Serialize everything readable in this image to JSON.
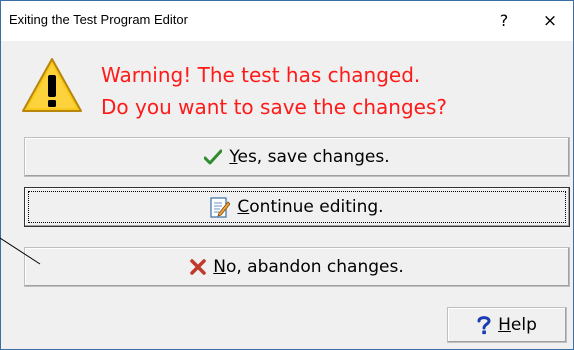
{
  "window": {
    "title": "Exiting the Test Program Editor",
    "help_glyph": "?",
    "close_glyph": "×"
  },
  "message": {
    "line1": "Warning! The test has changed.",
    "line2": "Do you want to save the changes?",
    "color": "#ff1a1a"
  },
  "buttons": {
    "yes": {
      "mnemonic": "Y",
      "rest": "es, save changes.",
      "icon": "checkmark-icon"
    },
    "continue": {
      "mnemonic": "C",
      "rest": "ontinue editing.",
      "icon": "edit-document-icon"
    },
    "no": {
      "mnemonic": "N",
      "rest": "o, abandon changes.",
      "icon": "red-x-icon"
    },
    "help": {
      "mnemonic": "H",
      "rest": "elp",
      "icon": "question-mark-icon"
    }
  },
  "colors": {
    "window_border": "#3a6ea5",
    "dialog_bg": "#f0f0f0",
    "check_green": "#2e8b2e",
    "x_red": "#c0392b",
    "help_blue": "#1a3cb3"
  }
}
